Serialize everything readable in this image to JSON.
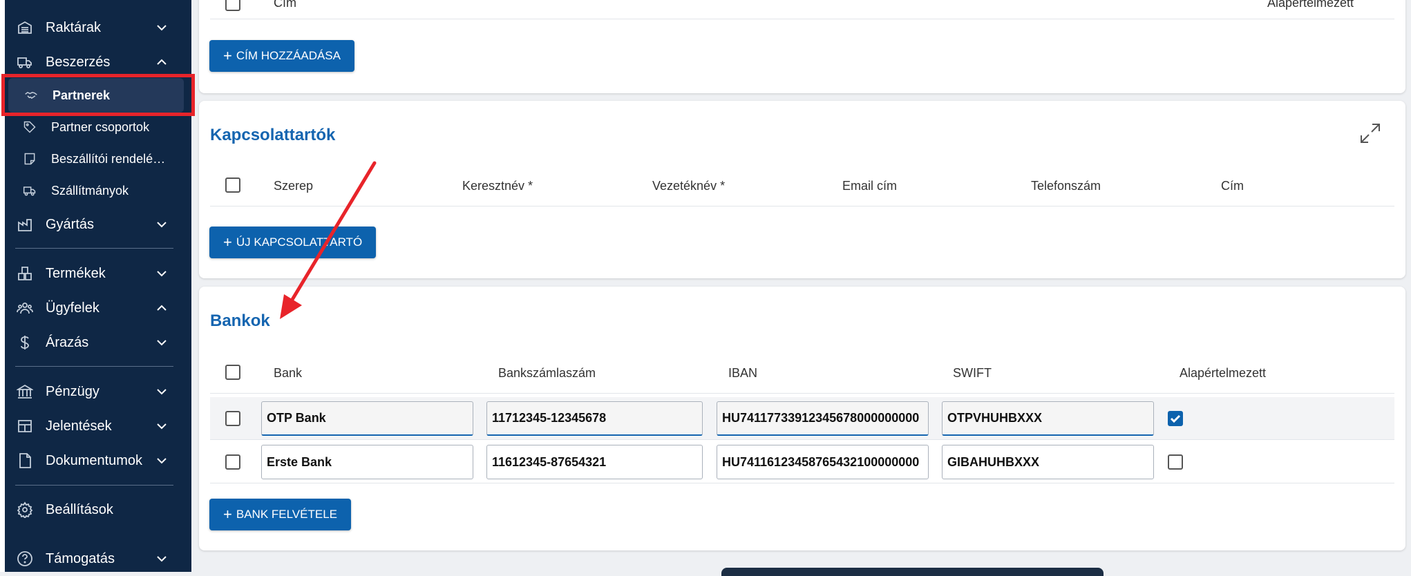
{
  "sidebar": {
    "items": [
      {
        "label": "Raktárak",
        "icon": "warehouse-icon",
        "expanded": false
      },
      {
        "label": "Beszerzés",
        "icon": "truck-icon",
        "expanded": true
      },
      {
        "label": "Gyártás",
        "icon": "factory-icon",
        "expanded": false
      },
      {
        "label": "Termékek",
        "icon": "boxes-icon",
        "expanded": false
      },
      {
        "label": "Ügyfelek",
        "icon": "users-icon",
        "expanded": true
      },
      {
        "label": "Árazás",
        "icon": "dollar-icon",
        "expanded": false
      },
      {
        "label": "Pénzügy",
        "icon": "bank-icon",
        "expanded": false
      },
      {
        "label": "Jelentések",
        "icon": "table-icon",
        "expanded": false
      },
      {
        "label": "Dokumentumok",
        "icon": "document-icon",
        "expanded": false
      },
      {
        "label": "Beállítások",
        "icon": "gear-icon"
      },
      {
        "label": "Támogatás",
        "icon": "help-icon",
        "expanded": false
      }
    ],
    "subitems": [
      {
        "label": "Partnerek",
        "icon": "handshake-icon",
        "active": true
      },
      {
        "label": "Partner csoportok",
        "icon": "tag-icon"
      },
      {
        "label": "Beszállítói rendelé…",
        "icon": "note-icon"
      },
      {
        "label": "Szállítmányok",
        "icon": "truck-icon"
      }
    ]
  },
  "addresses": {
    "headers": {
      "cim": "Cím",
      "alapertelmezett": "Alapértelmezett"
    },
    "add_button": "CÍM HOZZÁADÁSA"
  },
  "contacts": {
    "title": "Kapcsolattartók",
    "headers": [
      "Szerep",
      "Keresztnév *",
      "Vezetéknév *",
      "Email cím",
      "Telefonszám",
      "Cím"
    ],
    "add_button": "ÚJ KAPCSOLATTARTÓ"
  },
  "banks": {
    "title": "Bankok",
    "headers": [
      "Bank",
      "Bankszámlaszám",
      "IBAN",
      "SWIFT",
      "Alapértelmezett"
    ],
    "rows": [
      {
        "bank": "OTP Bank",
        "account": "11712345-12345678",
        "iban": "HU74117733912345678000000000",
        "swift": "OTPVHUHBXXX",
        "default": true
      },
      {
        "bank": "Erste Bank",
        "account": "11612345-87654321",
        "iban": "HU74116123458765432100000000",
        "swift": "GIBAHUHBXXX",
        "default": false
      }
    ],
    "add_button": "BANK FELVÉTELE"
  },
  "colors": {
    "accent": "#0d62ad",
    "title": "#1565b0",
    "sidebar": "#0f2745",
    "annotation": "#e8242a"
  }
}
